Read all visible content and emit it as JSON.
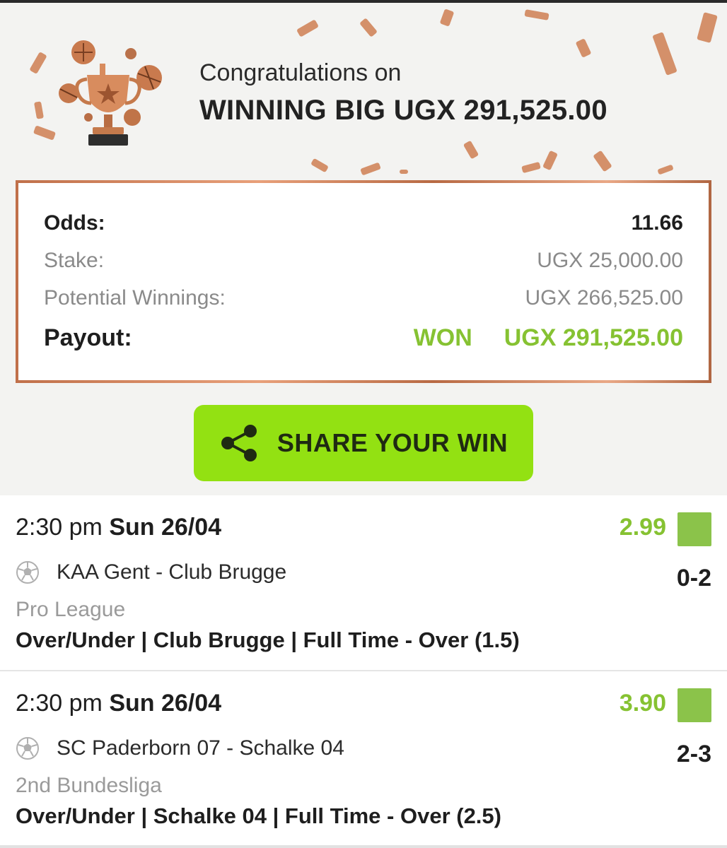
{
  "banner": {
    "congrats_text": "Congratulations on",
    "winning_text": "WINNING BIG UGX 291,525.00"
  },
  "summary": {
    "odds_label": "Odds:",
    "odds_value": "11.66",
    "stake_label": "Stake:",
    "stake_value": "UGX 25,000.00",
    "potential_label": "Potential Winnings:",
    "potential_value": "UGX 266,525.00",
    "payout_label": "Payout:",
    "payout_status": "WON",
    "payout_value": "UGX 291,525.00"
  },
  "share_button": {
    "label": "SHARE YOUR WIN",
    "icon": "share-icon"
  },
  "colors": {
    "accent_green": "#93e112",
    "won_green": "#86c232",
    "status_green": "#8bc34a",
    "bronze": "#c0704a"
  },
  "bets": [
    {
      "time": "2:30 pm",
      "date": "Sun 26/04",
      "odds": "2.99",
      "teams": "KAA Gent - Club Brugge",
      "score": "0-2",
      "league": "Pro League",
      "market": "Over/Under | Club Brugge | Full Time - Over (1.5)",
      "sport_icon": "soccer-ball-icon"
    },
    {
      "time": "2:30 pm",
      "date": "Sun 26/04",
      "odds": "3.90",
      "teams": "SC Paderborn 07 - Schalke 04",
      "score": "2-3",
      "league": "2nd Bundesliga",
      "market": "Over/Under | Schalke 04 | Full Time - Over (2.5)",
      "sport_icon": "soccer-ball-icon"
    }
  ]
}
